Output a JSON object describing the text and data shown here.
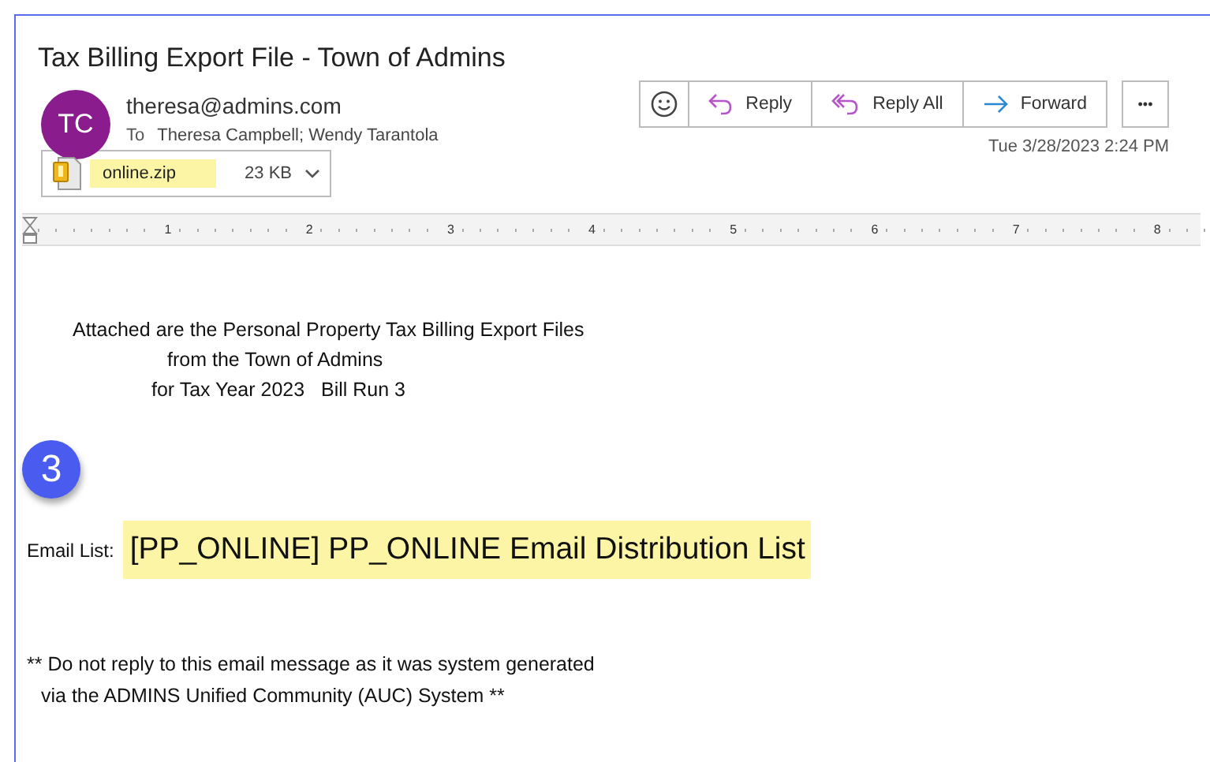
{
  "email": {
    "subject": "Tax Billing Export File - Town of Admins",
    "avatar_initials": "TC",
    "sender": "theresa@admins.com",
    "to_label": "To",
    "recipients": "Theresa Campbell; Wendy Tarantola",
    "date": "Tue 3/28/2023 2:24 PM"
  },
  "actions": [
    {
      "kind": "emoji"
    },
    {
      "kind": "reply",
      "label": "Reply"
    },
    {
      "kind": "reply_all",
      "label": "Reply All"
    },
    {
      "kind": "forward",
      "label": "Forward"
    }
  ],
  "more_label": "•••",
  "attachment": {
    "name": "online.zip",
    "size": "23 KB"
  },
  "ruler": {
    "numbers": [
      "1",
      "2",
      "3",
      "4",
      "5",
      "6",
      "7",
      "8"
    ]
  },
  "body": {
    "lines": [
      "Attached are the Personal Property Tax Billing Export Files",
      "from the Town of Admins",
      "for Tax Year 2023   Bill Run 3"
    ],
    "step_badge": "3",
    "list_label": "Email List:",
    "list_value": "[PP_ONLINE] PP_ONLINE Email Distribution List",
    "footer": [
      "** Do not reply to this email message as it was system generated",
      "via the ADMINS Unified Community (AUC) System **"
    ]
  }
}
